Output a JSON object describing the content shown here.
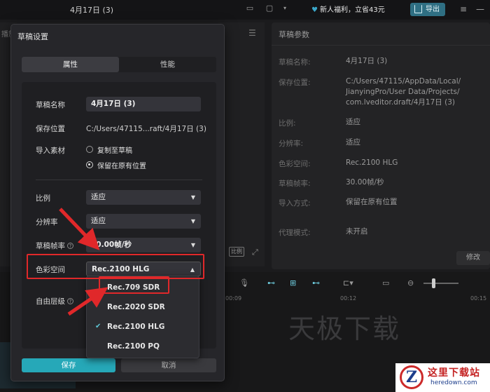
{
  "topbar": {
    "title": "4月17日 (3)",
    "promo": "新人福利，立省43元",
    "export_label": "导出"
  },
  "player": {
    "label": "播放"
  },
  "properties_panel": {
    "header": "草稿参数",
    "rows": [
      {
        "label": "草稿名称:",
        "value": "4月17日 (3)"
      },
      {
        "label": "保存位置:",
        "value_lines": [
          "C:/Users/47115/AppData/Local/",
          "JianyingPro/User Data/Projects/",
          "com.lveditor.draft/4月17日 (3)"
        ]
      },
      {
        "label": "比例:",
        "value": "适应"
      },
      {
        "label": "分辨率:",
        "value": "适应"
      },
      {
        "label": "色彩空间:",
        "value": "Rec.2100 HLG"
      },
      {
        "label": "草稿帧率:",
        "value": "30.00帧/秒"
      },
      {
        "label": "导入方式:",
        "value": "保留在原有位置"
      },
      {
        "label": "代理模式:",
        "value": "未开启"
      }
    ],
    "modify_label": "修改"
  },
  "player_controls": {
    "ratio_label": "比例"
  },
  "timeline": {
    "ticks": [
      "00:09",
      "00:12",
      "00:15"
    ],
    "watermark": "天极下载"
  },
  "logo": {
    "line1": "这里下载站",
    "line2": "heredown.com",
    "mark": "Z"
  },
  "dialog": {
    "title": "草稿设置",
    "tabs": [
      {
        "label": "属性",
        "active": true
      },
      {
        "label": "性能",
        "active": false
      }
    ],
    "fields": {
      "name_label": "草稿名称",
      "name_value": "4月17日 (3)",
      "location_label": "保存位置",
      "location_value": "C:/Users/47115...raft/4月17日 (3)",
      "import_label": "导入素材",
      "import_options": [
        {
          "label": "复制至草稿",
          "checked": false
        },
        {
          "label": "保留在原有位置",
          "checked": true
        }
      ],
      "ratio_label": "比例",
      "ratio_value": "适应",
      "resolution_label": "分辨率",
      "resolution_value": "适应",
      "framerate_label": "草稿帧率",
      "framerate_value": "30.00帧/秒",
      "colorspace_label": "色彩空间",
      "colorspace_value": "Rec.2100 HLG",
      "layer_label": "自由层级"
    },
    "save_label": "保存",
    "cancel_label": "取消"
  },
  "colorspace_menu": {
    "options": [
      {
        "label": "Rec.709 SDR",
        "selected": false
      },
      {
        "label": "Rec.2020 SDR",
        "selected": false
      },
      {
        "label": "Rec.2100 HLG",
        "selected": true
      },
      {
        "label": "Rec.2100 PQ",
        "selected": false
      }
    ]
  },
  "colors": {
    "accent": "#26a8b8",
    "annotation": "#e0282a",
    "dialog_bg": "#26262a"
  }
}
